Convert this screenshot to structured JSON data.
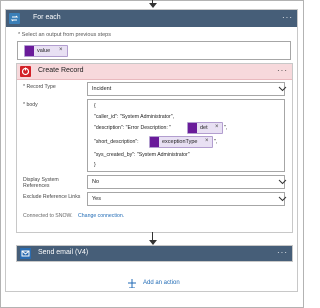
{
  "foreach": {
    "title": "For each",
    "select_label": "* Select an output from previous steps",
    "token": "value"
  },
  "create_record": {
    "title": "Create Record",
    "record_type_label": "* Record Type",
    "record_type_value": "Incident",
    "body_label": "* body",
    "body_lines": {
      "open": "{",
      "caller": "\"caller_id\": \"System Administrator\",",
      "description_prefix": "\"description\": \"Error Description: \"",
      "description_token": "det",
      "description_suffix": "\",",
      "short_prefix": "\"short_description\":",
      "short_token": "exceptionType",
      "short_suffix": "\",",
      "sys_created": "\"sys_created_by\": \"System Administrator\"",
      "close": "}"
    },
    "display_label_1": "Display System",
    "display_label_2": "References",
    "display_value": "No",
    "exclude_label": "Exclude Reference Links",
    "exclude_value": "Yes",
    "connected_text": "Connected to SNOW.",
    "change_connection": "Change connection."
  },
  "send_email": {
    "title": "Send email (V4)"
  },
  "add_action": "Add an action",
  "icons": {
    "loop": "loop-icon",
    "servicenow": "servicenow-icon",
    "outlook": "outlook-icon",
    "expression": "expression-icon"
  }
}
